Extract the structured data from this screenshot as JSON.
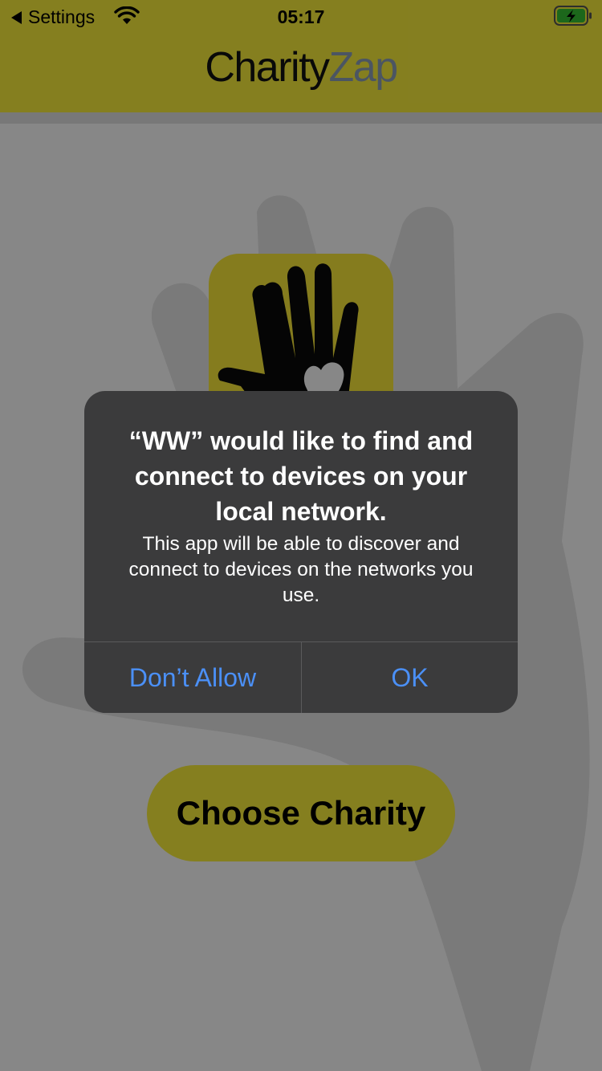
{
  "status_bar": {
    "back_label": "Settings",
    "time": "05:17",
    "wifi_icon": "wifi-icon",
    "battery_icon": "battery-charging-icon",
    "battery_color": "#36c334"
  },
  "header": {
    "logo_part1": "Charity",
    "logo_part2": "Zap",
    "background": "#fcf03c"
  },
  "main": {
    "app_icon": "raised-hand-heart-icon",
    "choose_button_label": "Choose Charity"
  },
  "alert": {
    "title": "“WW” would like to find and connect to devices on your local network.",
    "message": "This app will be able to discover and connect to devices on the networks you use.",
    "buttons": [
      {
        "label": "Don’t Allow"
      },
      {
        "label": "OK"
      }
    ],
    "button_color": "#4b90f7"
  }
}
